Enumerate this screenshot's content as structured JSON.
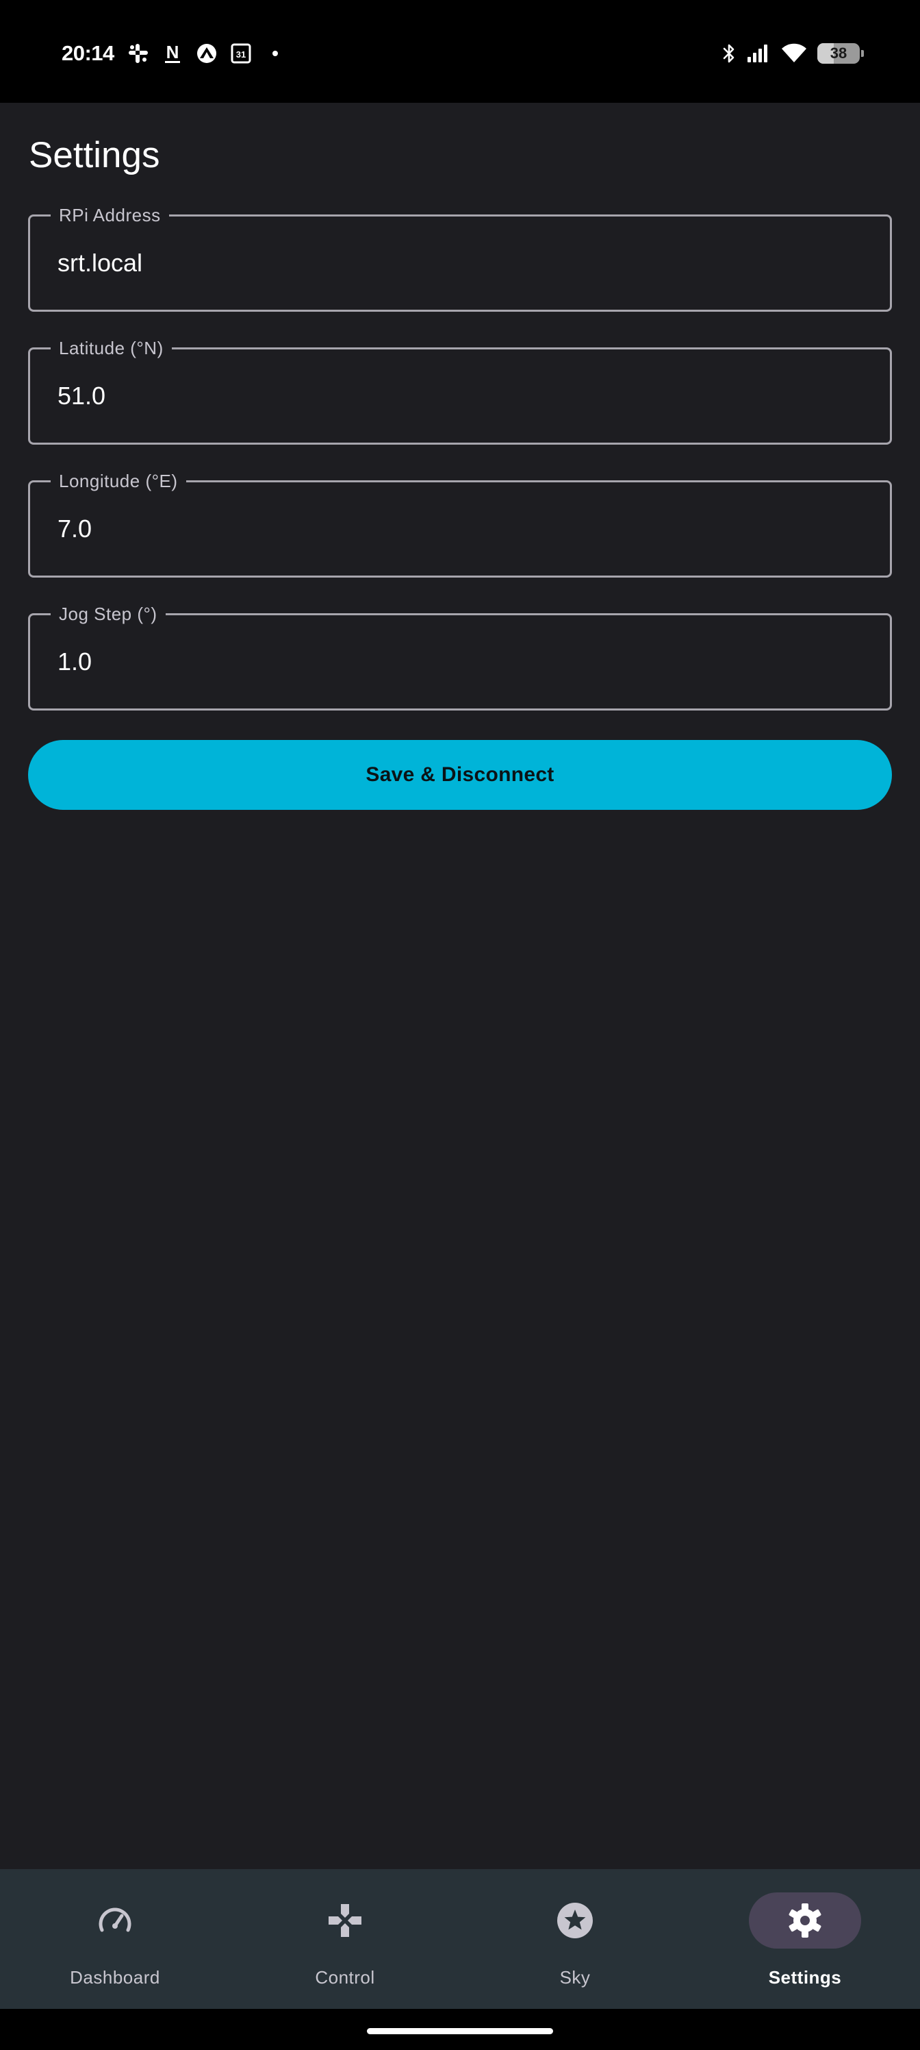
{
  "status_bar": {
    "time": "20:14",
    "notification_icons": [
      "slack-icon",
      "notion-icon",
      "cloud-app-icon",
      "calendar-icon",
      "more-notifications-dot"
    ],
    "calendar_day": "31",
    "notion_letter": "N",
    "system_icons": [
      "bluetooth-icon",
      "signal-icon",
      "wifi-icon",
      "battery-icon"
    ],
    "battery_percent": "38",
    "battery_level_fraction": 0.38
  },
  "screen": {
    "title": "Settings"
  },
  "fields": [
    {
      "label": "RPi Address",
      "value": "srt.local"
    },
    {
      "label": "Latitude (°N)",
      "value": "51.0"
    },
    {
      "label": "Longitude (°E)",
      "value": "7.0"
    },
    {
      "label": "Jog Step (°)",
      "value": "1.0"
    }
  ],
  "save_button": {
    "label": "Save & Disconnect"
  },
  "bottom_nav": {
    "items": [
      {
        "label": "Dashboard",
        "icon": "speedometer-icon",
        "active": false
      },
      {
        "label": "Control",
        "icon": "gamepad-icon",
        "active": false
      },
      {
        "label": "Sky",
        "icon": "star-icon",
        "active": false
      },
      {
        "label": "Settings",
        "icon": "gear-icon",
        "active": true
      }
    ]
  },
  "colors": {
    "background": "#1d1d21",
    "accent": "#00b4d8",
    "nav_background": "#283238",
    "active_pill": "#4a4458",
    "outline": "#a7a5ad"
  }
}
